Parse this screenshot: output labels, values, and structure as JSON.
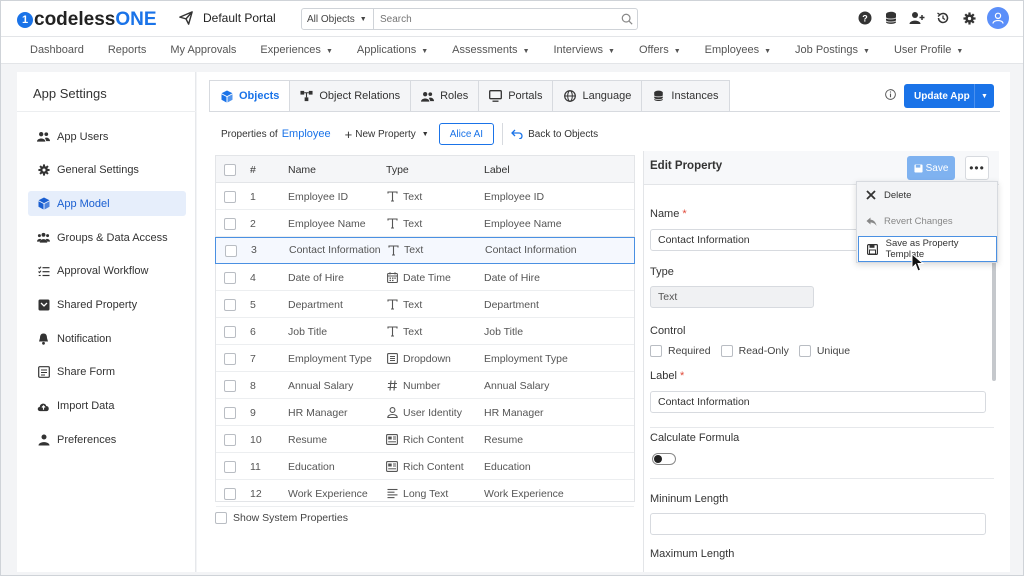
{
  "app": {
    "logo_prefix": "1",
    "logo_text": "codeless",
    "logo_suffix": "ONE",
    "portal": "Default Portal"
  },
  "search": {
    "scope": "All Objects",
    "placeholder": "Search"
  },
  "nav": [
    "Dashboard",
    "Reports",
    "My Approvals",
    "Experiences",
    "Applications",
    "Assessments",
    "Interviews",
    "Offers",
    "Employees",
    "Job Postings",
    "User Profile"
  ],
  "nav_dropdown": [
    false,
    false,
    false,
    true,
    true,
    true,
    true,
    true,
    true,
    true,
    true
  ],
  "sidebar": {
    "title": "App Settings",
    "items": [
      {
        "label": "App Users",
        "icon": "users-icon"
      },
      {
        "label": "General Settings",
        "icon": "gear-icon"
      },
      {
        "label": "App Model",
        "icon": "cube-icon",
        "active": true
      },
      {
        "label": "Groups & Data Access",
        "icon": "group-icon"
      },
      {
        "label": "Approval Workflow",
        "icon": "checklist-icon"
      },
      {
        "label": "Shared Property",
        "icon": "folder-icon"
      },
      {
        "label": "Notification",
        "icon": "bell-icon"
      },
      {
        "label": "Share Form",
        "icon": "form-icon"
      },
      {
        "label": "Import Data",
        "icon": "cloud-upload-icon"
      },
      {
        "label": "Preferences",
        "icon": "person-settings-icon"
      }
    ]
  },
  "tabs": [
    {
      "label": "Objects",
      "icon": "cube-icon",
      "active": true
    },
    {
      "label": "Object Relations",
      "icon": "relations-icon"
    },
    {
      "label": "Roles",
      "icon": "users-icon"
    },
    {
      "label": "Portals",
      "icon": "monitor-icon"
    },
    {
      "label": "Language",
      "icon": "globe-icon"
    },
    {
      "label": "Instances",
      "icon": "database-icon"
    }
  ],
  "update_button": "Update App",
  "subbar": {
    "properties_of": "Properties of",
    "object": "Employee",
    "new_property": "New Property",
    "ai": "Alice AI",
    "back": "Back to Objects"
  },
  "table": {
    "headers": {
      "num": "#",
      "name": "Name",
      "type": "Type",
      "label": "Label"
    },
    "rows": [
      {
        "num": "1",
        "name": "Employee ID",
        "type": "Text",
        "type_icon": "text-icon",
        "label": "Employee ID"
      },
      {
        "num": "2",
        "name": "Employee Name",
        "type": "Text",
        "type_icon": "text-icon",
        "label": "Employee Name"
      },
      {
        "num": "3",
        "name": "Contact Information",
        "type": "Text",
        "type_icon": "text-icon",
        "label": "Contact Information",
        "selected": true
      },
      {
        "num": "4",
        "name": "Date of Hire",
        "type": "Date Time",
        "type_icon": "calendar-icon",
        "label": "Date of Hire"
      },
      {
        "num": "5",
        "name": "Department",
        "type": "Text",
        "type_icon": "text-icon",
        "label": "Department"
      },
      {
        "num": "6",
        "name": "Job Title",
        "type": "Text",
        "type_icon": "text-icon",
        "label": "Job Title"
      },
      {
        "num": "7",
        "name": "Employment Type",
        "type": "Dropdown",
        "type_icon": "dropdown-icon",
        "label": "Employment Type"
      },
      {
        "num": "8",
        "name": "Annual Salary",
        "type": "Number",
        "type_icon": "hash-icon",
        "label": "Annual Salary"
      },
      {
        "num": "9",
        "name": "HR Manager",
        "type": "User Identity",
        "type_icon": "user-icon",
        "label": "HR Manager"
      },
      {
        "num": "10",
        "name": "Resume",
        "type": "Rich Content",
        "type_icon": "rich-content-icon",
        "label": "Resume"
      },
      {
        "num": "11",
        "name": "Education",
        "type": "Rich Content",
        "type_icon": "rich-content-icon",
        "label": "Education"
      },
      {
        "num": "12",
        "name": "Work Experience",
        "type": "Long Text",
        "type_icon": "long-text-icon",
        "label": "Work Experience"
      }
    ],
    "show_system": "Show System Properties"
  },
  "edit": {
    "title": "Edit Property",
    "save": "Save",
    "name_label": "Name",
    "name_value": "Contact Information",
    "type_label": "Type",
    "type_value": "Text",
    "control_label": "Control",
    "controls": [
      "Required",
      "Read-Only",
      "Unique"
    ],
    "label_label": "Label",
    "label_value": "Contact Information",
    "formula_label": "Calculate Formula",
    "min_label": "Mininum Length",
    "max_label": "Maximum Length"
  },
  "menu": [
    {
      "label": "Delete",
      "icon": "close-icon"
    },
    {
      "label": "Revert Changes",
      "icon": "revert-icon",
      "disabled": true
    },
    {
      "label": "Save as Property Template",
      "icon": "save-icon",
      "highlight": true
    }
  ]
}
